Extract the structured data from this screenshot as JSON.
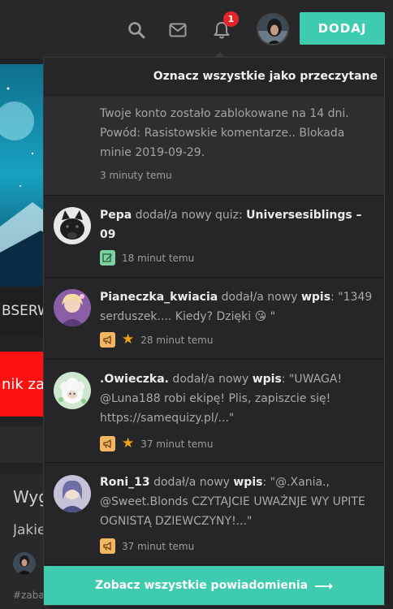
{
  "header": {
    "bell_badge": "1",
    "add_button": "DODAJ"
  },
  "background_page": {
    "banner_text": "BSERW",
    "red_banner_text": "nik za",
    "post_title": "Wyg",
    "post_subtitle": "Jakie",
    "post_tag": "#zaba"
  },
  "notifications_panel": {
    "mark_all_read": "Oznacz wszystkie jako przeczytane",
    "see_all": "Zobacz wszystkie powiadomienia",
    "items": [
      {
        "text": "Twoje konto zostało zablokowane na 14 dni. Powód: Rasistowskie komentarze.. Blokada minie 2019-09-29.",
        "time": "3 minuty temu"
      },
      {
        "user": "Pepa",
        "action": " dodał/a nowy quiz: ",
        "target": "Universesiblings – 09",
        "time": "18 minut temu",
        "type_icon": "edit-icon"
      },
      {
        "user": "Pianeczka_kwiacia",
        "action": " dodał/a nowy ",
        "target": "wpis",
        "quote": ": \"1349 serduszek.... Kiedy? Dzięki 😘 \"",
        "time": "28 minut temu",
        "type_icon": "megaphone-icon",
        "starred": true
      },
      {
        "user": ".Owieczka.",
        "action": " dodał/a nowy ",
        "target": "wpis",
        "quote": ": \"UWAGA! @Luna188 robi ekipę! Plis, zapiszcie się! https://samequizy.pl/...\"",
        "time": "37 minut temu",
        "type_icon": "megaphone-icon",
        "starred": true
      },
      {
        "user": "Roni_13",
        "action": " dodał/a nowy ",
        "target": "wpis",
        "quote": ": \"@.Xania., @Sweet.Blonds CZYTAJCIE UWAŻNJE WY UPITE OGNISTĄ DZIEWCZYNY!...\"",
        "time": "37 minut temu",
        "type_icon": "megaphone-icon"
      }
    ]
  },
  "colors": {
    "accent": "#3ecbaf",
    "badge": "#e5242a",
    "star": "#f6a21a"
  }
}
